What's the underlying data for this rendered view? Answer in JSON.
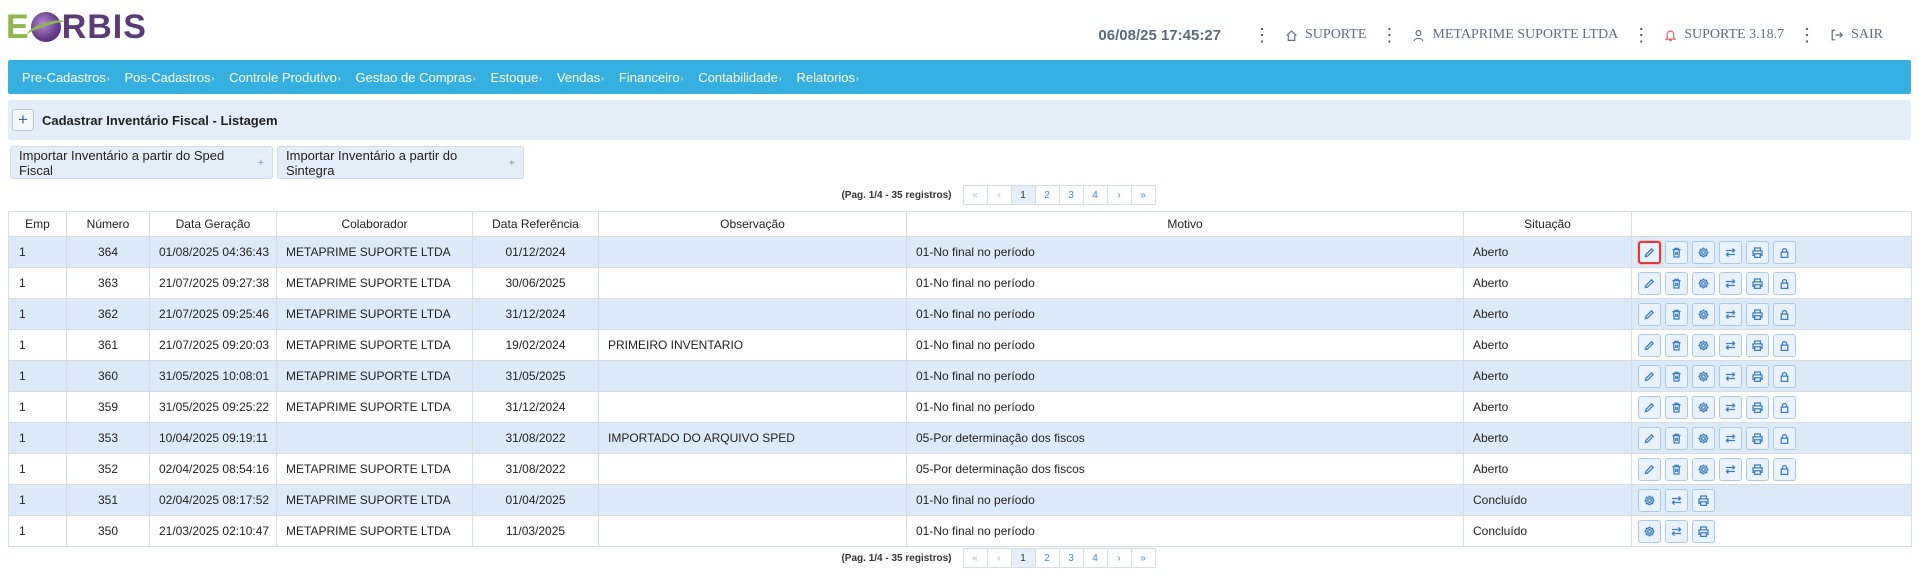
{
  "logo": {
    "text_e": "E",
    "text_rest": "RBIS"
  },
  "header": {
    "datetime": "06/08/25 17:45:27",
    "items": [
      {
        "icon": "home-icon",
        "label": "SUPORTE"
      },
      {
        "icon": "user-icon",
        "label": "METAPRIME SUPORTE LTDA"
      },
      {
        "icon": "bell-icon",
        "label": "SUPORTE 3.18.7"
      },
      {
        "icon": "logout-icon",
        "label": "SAIR"
      }
    ]
  },
  "nav": [
    "Pre-Cadastros",
    "Pos-Cadastros",
    "Controle Produtivo",
    "Gestao de Compras",
    "Estoque",
    "Vendas",
    "Financeiro",
    "Contabilidade",
    "Relatorios"
  ],
  "page_title": "Cadastrar Inventário Fiscal - Listagem",
  "imports": [
    "Importar Inventário a partir do Sped Fiscal",
    "Importar Inventário a partir do Sintegra"
  ],
  "pagination": {
    "info": "(Pag. 1/4 - 35 registros)",
    "first": "«",
    "prev": "‹",
    "pages": [
      "1",
      "2",
      "3",
      "4"
    ],
    "next": "›",
    "last": "»"
  },
  "columns": [
    "Emp",
    "Número",
    "Data Geração",
    "Colaborador",
    "Data Referência",
    "Observação",
    "Motivo",
    "Situação",
    ""
  ],
  "rows": [
    {
      "emp": "1",
      "numero": "364",
      "data_geracao": "01/08/2025 04:36:43",
      "colaborador": "METAPRIME SUPORTE LTDA",
      "data_referencia": "01/12/2024",
      "observacao": "",
      "motivo": "01-No final no período",
      "situacao": "Aberto"
    },
    {
      "emp": "1",
      "numero": "363",
      "data_geracao": "21/07/2025 09:27:38",
      "colaborador": "METAPRIME SUPORTE LTDA",
      "data_referencia": "30/06/2025",
      "observacao": "",
      "motivo": "01-No final no período",
      "situacao": "Aberto"
    },
    {
      "emp": "1",
      "numero": "362",
      "data_geracao": "21/07/2025 09:25:46",
      "colaborador": "METAPRIME SUPORTE LTDA",
      "data_referencia": "31/12/2024",
      "observacao": "",
      "motivo": "01-No final no período",
      "situacao": "Aberto"
    },
    {
      "emp": "1",
      "numero": "361",
      "data_geracao": "21/07/2025 09:20:03",
      "colaborador": "METAPRIME SUPORTE LTDA",
      "data_referencia": "19/02/2024",
      "observacao": "PRIMEIRO INVENTARIO",
      "motivo": "01-No final no período",
      "situacao": "Aberto"
    },
    {
      "emp": "1",
      "numero": "360",
      "data_geracao": "31/05/2025 10:08:01",
      "colaborador": "METAPRIME SUPORTE LTDA",
      "data_referencia": "31/05/2025",
      "observacao": "",
      "motivo": "01-No final no período",
      "situacao": "Aberto"
    },
    {
      "emp": "1",
      "numero": "359",
      "data_geracao": "31/05/2025 09:25:22",
      "colaborador": "METAPRIME SUPORTE LTDA",
      "data_referencia": "31/12/2024",
      "observacao": "",
      "motivo": "01-No final no período",
      "situacao": "Aberto"
    },
    {
      "emp": "1",
      "numero": "353",
      "data_geracao": "10/04/2025 09:19:11",
      "colaborador": "",
      "data_referencia": "31/08/2022",
      "observacao": "IMPORTADO DO ARQUIVO SPED",
      "motivo": "05-Por determinação dos fiscos",
      "situacao": "Aberto"
    },
    {
      "emp": "1",
      "numero": "352",
      "data_geracao": "02/04/2025 08:54:16",
      "colaborador": "METAPRIME SUPORTE LTDA",
      "data_referencia": "31/08/2022",
      "observacao": "",
      "motivo": "05-Por determinação dos fiscos",
      "situacao": "Aberto"
    },
    {
      "emp": "1",
      "numero": "351",
      "data_geracao": "02/04/2025 08:17:52",
      "colaborador": "METAPRIME SUPORTE LTDA",
      "data_referencia": "01/04/2025",
      "observacao": "",
      "motivo": "01-No final no período",
      "situacao": "Concluído"
    },
    {
      "emp": "1",
      "numero": "350",
      "data_geracao": "21/03/2025 02:10:47",
      "colaborador": "METAPRIME SUPORTE LTDA",
      "data_referencia": "11/03/2025",
      "observacao": "",
      "motivo": "01-No final no período",
      "situacao": "Concluído"
    }
  ],
  "action_sets": {
    "open": [
      "edit-icon",
      "trash-icon",
      "gear-icon",
      "transfer-icon",
      "print-icon",
      "lock-icon"
    ],
    "closed": [
      "gear-icon",
      "transfer-icon",
      "print-icon"
    ]
  },
  "colors": {
    "nav": "#35aee0",
    "row_alt": "#ddebf8",
    "highlight": "#e03b3b"
  }
}
